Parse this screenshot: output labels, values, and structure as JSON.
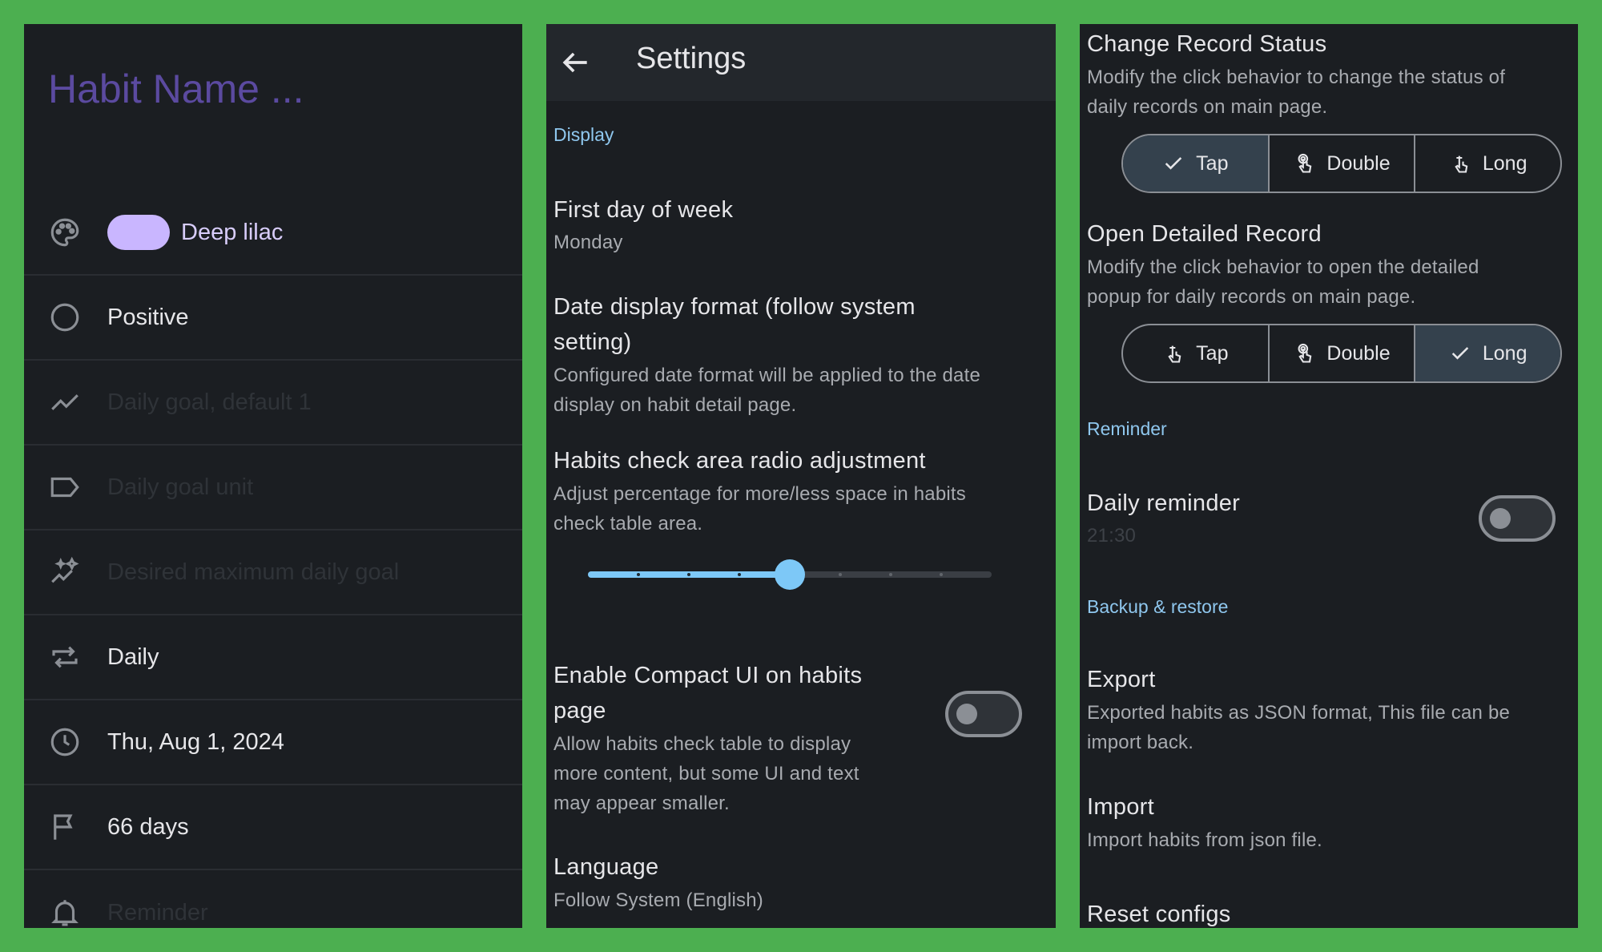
{
  "habit_form": {
    "name_placeholder": "Habit Name ...",
    "color_label": "Deep lilac",
    "color_hex": "#c9b6ff",
    "type_label": "Positive",
    "daily_goal_placeholder": "Daily goal, default 1",
    "daily_goal_unit_placeholder": "Daily goal unit",
    "max_goal_placeholder": "Desired maximum daily goal",
    "frequency_label": "Daily",
    "start_date": "Thu, Aug 1, 2024",
    "target_days": "66 days",
    "reminder_placeholder": "Reminder"
  },
  "settings": {
    "title": "Settings",
    "display_section": "Display",
    "first_day_title": "First day of week",
    "first_day_value": "Monday",
    "date_format_title_1": "Date display format (follow system",
    "date_format_title_2": "setting)",
    "date_format_sub_1": "Configured date format will be applied to the date",
    "date_format_sub_2": "display on habit detail page.",
    "check_area_title": "Habits check area radio adjustment",
    "check_area_sub_1": "Adjust percentage for more/less space in habits",
    "check_area_sub_2": "check table area.",
    "check_area_slider": {
      "value": 4,
      "min": 0,
      "max": 8
    },
    "compact_title_1": "Enable Compact UI on habits",
    "compact_title_2": "page",
    "compact_sub_1": "Allow habits check table to display",
    "compact_sub_2": "more content, but some UI and text",
    "compact_sub_3": "may appear smaller.",
    "compact_enabled": false,
    "language_title": "Language",
    "language_value": "Follow System (English)"
  },
  "settings2": {
    "change_status_title": "Change Record Status",
    "change_status_sub_1": "Modify the click behavior to change the status of",
    "change_status_sub_2": "daily records on main page.",
    "change_status_options": [
      "Tap",
      "Double",
      "Long"
    ],
    "change_status_selected": "Tap",
    "open_detail_title": "Open Detailed Record",
    "open_detail_sub_1": "Modify the click behavior to open the detailed",
    "open_detail_sub_2": "popup for daily records on main page.",
    "open_detail_options": [
      "Tap",
      "Double",
      "Long"
    ],
    "open_detail_selected": "Long",
    "reminder_section": "Reminder",
    "daily_reminder_title": "Daily reminder",
    "daily_reminder_time": "21:30",
    "daily_reminder_enabled": false,
    "backup_section": "Backup & restore",
    "export_title": "Export",
    "export_sub_1": "Exported habits as JSON format, This file can be",
    "export_sub_2": "import back.",
    "import_title": "Import",
    "import_sub": "Import habits from json file.",
    "reset_title": "Reset configs"
  },
  "colors": {
    "frame": "#4caf50",
    "panel": "#1b1e22",
    "accent": "#8fc7ee",
    "habit_name": "#5b4aa0"
  }
}
